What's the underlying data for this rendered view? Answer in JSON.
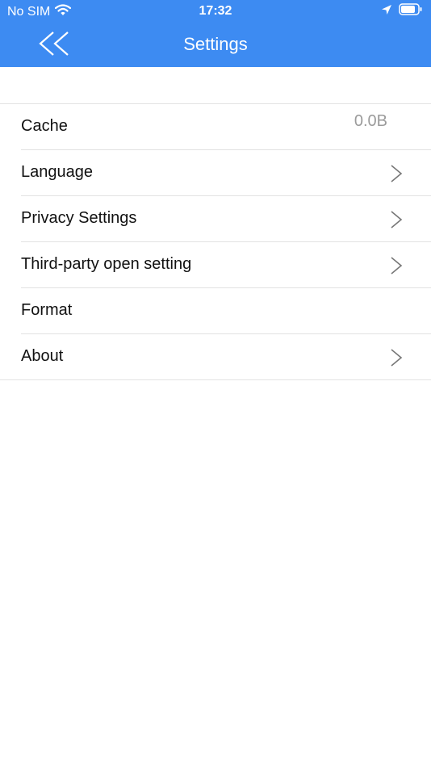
{
  "status_bar": {
    "carrier": "No SIM",
    "time": "17:32"
  },
  "nav": {
    "title": "Settings",
    "back_icon": "double-chevron-left-icon"
  },
  "settings": [
    {
      "label": "Cache",
      "value": "0.0B",
      "has_chevron": false
    },
    {
      "label": "Language",
      "has_chevron": true
    },
    {
      "label": "Privacy Settings",
      "has_chevron": true
    },
    {
      "label": "Third-party open setting",
      "has_chevron": true
    },
    {
      "label": "Format",
      "has_chevron": false
    },
    {
      "label": "About",
      "has_chevron": true
    }
  ],
  "colors": {
    "header": "#3d8bf2",
    "divider": "#e2e2e2",
    "value_text": "#9b9b9b"
  }
}
